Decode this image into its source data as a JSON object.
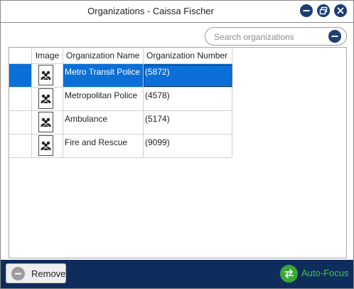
{
  "window": {
    "title": "Organizations - Caissa Fischer"
  },
  "search": {
    "placeholder": "Search organizations",
    "value": ""
  },
  "table": {
    "columns": [
      "Image",
      "Organization Name",
      "Organization Number"
    ],
    "rows": [
      {
        "name": "Metro Transit Police",
        "number": "(5872)",
        "selected": true
      },
      {
        "name": "Metropolitan Police",
        "number": "(4578)",
        "selected": false
      },
      {
        "name": "Ambulance",
        "number": "(5174)",
        "selected": false
      },
      {
        "name": "Fire and Rescue",
        "number": "(9099)",
        "selected": false
      }
    ]
  },
  "footer": {
    "remove_label": "Remove",
    "autofocus_label": "Auto-Focus"
  },
  "icons": {
    "minimize": "minimize-icon",
    "restore": "restore-icon",
    "close": "close-icon",
    "search": "search-icon",
    "remove": "remove-icon",
    "autofocus": "swap-arrows-icon",
    "org_image": "group-people-icon"
  },
  "colors": {
    "accent": "#1b3f75",
    "selection": "#0a6fd6",
    "footer": "#0e2d5c",
    "autofocus": "#3aa637"
  }
}
